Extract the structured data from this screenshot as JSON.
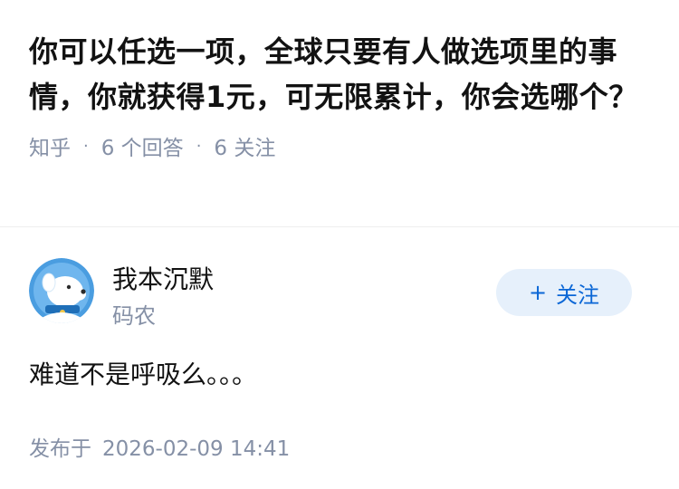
{
  "question": {
    "title": "你可以任选一项，全球只要有人做选项里的事情，你就获得1元，可无限累计，你会选哪个？",
    "source": "知乎",
    "separator": "·",
    "answer_count_label": "6 个回答",
    "follower_count_label": "6 关注"
  },
  "author": {
    "name": "我本沉默",
    "tagline": "码农",
    "follow_label": "关注",
    "follow_icon": "plus-icon",
    "avatar_icon": "cartoon-dog-avatar"
  },
  "answer": {
    "text": "难道不是呼吸么。。。",
    "posted_label": "发布于",
    "posted_time": "2026-02-09 14:41"
  },
  "colors": {
    "primary_text": "#121212",
    "secondary_text": "#8590a6",
    "accent_blue": "#0a66d6",
    "button_bg": "#e6f0fb",
    "avatar_bg": "#4a9de0"
  }
}
